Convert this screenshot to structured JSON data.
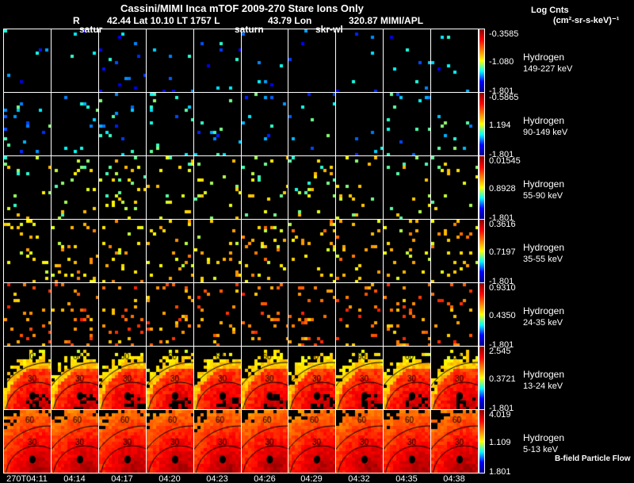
{
  "header": {
    "title": "Cassini/MIMI Inca mTOF  2009-270    Stare    Ions Only",
    "r_label": "R",
    "position_line": "42.44 Lat 10.10 LT 1757 L",
    "lon_line": "43.79 Lon",
    "mimi_line": "320.87  MIMI/APL",
    "markers": [
      "satur",
      "saturn",
      "skr-wl"
    ],
    "units_line1": "Log Cnts",
    "units_line2": "(cm²-sr-s-keV)⁻¹"
  },
  "footer": {
    "flow_label": "B-field Particle Flow"
  },
  "chart_data": {
    "type": "heatmap",
    "columns": [
      "270T04:11",
      "04:14",
      "04:17",
      "04:20",
      "04:23",
      "04:26",
      "04:29",
      "04:32",
      "04:35",
      "04:38"
    ],
    "rows": [
      {
        "species": "Hydrogen",
        "energy": "149-227 keV",
        "max": "-0.3585",
        "mid": "-1.080",
        "min": "-1.801"
      },
      {
        "species": "Hydrogen",
        "energy": "90-149 keV",
        "max": "-0.5865",
        "mid": "1.194",
        "min": "-1.801"
      },
      {
        "species": "Hydrogen",
        "energy": "55-90 keV",
        "max": "0.01545",
        "mid": "0.8928",
        "min": "-1.801"
      },
      {
        "species": "Hydrogen",
        "energy": "35-55 keV",
        "max": "0.3616",
        "mid": "0.7197",
        "min": "-1.801"
      },
      {
        "species": "Hydrogen",
        "energy": "24-35 keV",
        "max": "0.9310",
        "mid": "0.4350",
        "min": "-1.801"
      },
      {
        "species": "Hydrogen",
        "energy": "13-24 keV",
        "max": "2.545",
        "mid": "0.3721",
        "min": "-1.801"
      },
      {
        "species": "Hydrogen",
        "energy": "5-13 keV",
        "max": "4.019",
        "mid": "1.109",
        "min": "1.801"
      }
    ],
    "contour_labels": [
      "30",
      "60"
    ],
    "colormap": [
      "#00008f",
      "#0000ff",
      "#00ffff",
      "#ffff00",
      "#ff7f00",
      "#ff0000",
      "#8f0000"
    ]
  }
}
